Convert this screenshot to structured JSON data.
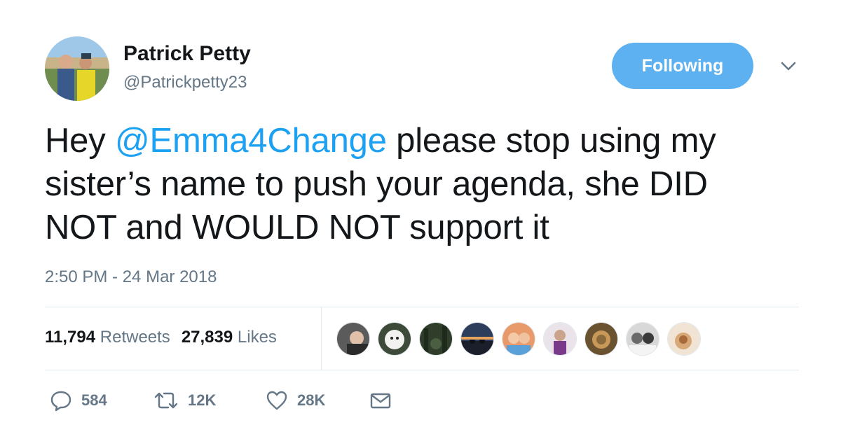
{
  "author": {
    "name": "Patrick Petty",
    "handle": "@Patrickpetty23",
    "avatar_icon": "profile-photo"
  },
  "follow_button": {
    "label": "Following",
    "color": "#5eb1f0"
  },
  "menu": {
    "icon": "chevron-down-icon"
  },
  "tweet": {
    "text_lines": [
      {
        "before": "Hey ",
        "mention": "@Emma4Change",
        "after": " please stop using my"
      },
      {
        "text": "sister’s name to push your agenda, she DID"
      },
      {
        "text": "NOT and WOULD NOT support it"
      }
    ],
    "timestamp": "2:50 PM - 24 Mar 2018"
  },
  "stats": {
    "retweets": {
      "count": "11,794",
      "label": "Retweets"
    },
    "likes": {
      "count": "27,839",
      "label": "Likes"
    }
  },
  "liker_avatars": [
    {
      "icon": "liker-avatar-1"
    },
    {
      "icon": "liker-avatar-2"
    },
    {
      "icon": "liker-avatar-3"
    },
    {
      "icon": "liker-avatar-4"
    },
    {
      "icon": "liker-avatar-5"
    },
    {
      "icon": "liker-avatar-6"
    },
    {
      "icon": "liker-avatar-7"
    },
    {
      "icon": "liker-avatar-8"
    },
    {
      "icon": "liker-avatar-9"
    }
  ],
  "actions": {
    "reply": {
      "icon": "reply-icon",
      "count": "584"
    },
    "retweet": {
      "icon": "retweet-icon",
      "count": "12K"
    },
    "like": {
      "icon": "heart-icon",
      "count": "28K"
    },
    "dm": {
      "icon": "envelope-icon"
    }
  },
  "colors": {
    "mention": "#1da1f2",
    "secondary_text": "#657786",
    "primary_text": "#14171a",
    "divider": "#e1e8ed"
  }
}
